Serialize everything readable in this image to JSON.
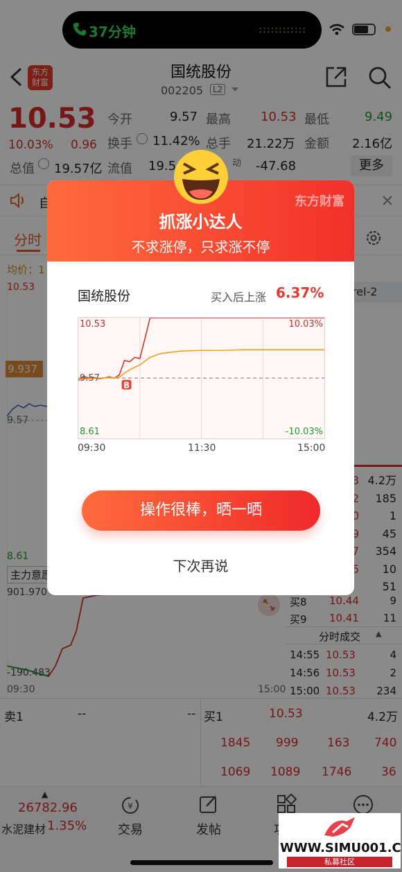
{
  "status_bar": {
    "call_time": "37分钟"
  },
  "header": {
    "logo_text_top": "东方",
    "logo_text_bottom": "财富",
    "title": "国统股份",
    "code": "002205",
    "level_badge": "L2"
  },
  "quote": {
    "price": "10.53",
    "change_pct": "10.03%",
    "change": "0.96",
    "open_label": "今开",
    "open": "9.57",
    "high_label": "最高",
    "high": "10.53",
    "low_label": "最低",
    "low": "9.49",
    "turnover_rate_label": "换手",
    "turnover_rate": "11.42%",
    "volume_label": "总手",
    "volume": "21.22万",
    "amount_label": "金额",
    "amount": "2.16亿",
    "total_value_label": "总值",
    "total_value": "19.57亿",
    "float_value_label": "流值",
    "float_value_partial": "19.5",
    "flow_partial_label": "动",
    "flow_value": "-47.68",
    "more_button": "更多"
  },
  "ticker_strip": {
    "partial_text": "自"
  },
  "tabs": {
    "intraday": "分时",
    "level2_partial": "rel-2"
  },
  "left_chart": {
    "avg_price_label": "均价：1",
    "price_top": "10.53",
    "price_badge": "9.937",
    "price_mid": "9.57",
    "price_low": "8.61",
    "indicator_label": "主力意愿",
    "indicator_top": "901.970",
    "indicator_bottom": "-190.483",
    "time_start": "09:30",
    "time_end": "15:00"
  },
  "order_book": {
    "right_volumes": [
      "4.2万",
      "185",
      "1",
      "45",
      "354",
      "10",
      "51"
    ],
    "right_partial_prices": [
      "3",
      "2",
      "0",
      "9",
      "7",
      "5"
    ],
    "rows": [
      {
        "label": "买8",
        "price": "10.44",
        "vol": "9"
      },
      {
        "label": "买9",
        "price": "10.41",
        "vol": "11"
      }
    ]
  },
  "trades": {
    "title": "分时成交",
    "rows": [
      {
        "time": "14:55",
        "price": "10.53",
        "vol": "4"
      },
      {
        "time": "14:56",
        "price": "10.53",
        "vol": "2"
      },
      {
        "time": "15:00",
        "price": "10.53",
        "vol": "234"
      }
    ]
  },
  "bottom_book": {
    "sell1_label": "卖1",
    "sell1_price": "--",
    "sell1_vol": "--",
    "buy1_label": "买1",
    "buy1_price": "10.53",
    "buy1_vol": "4.2万",
    "row1": [
      "1845",
      "999",
      "163",
      "740"
    ],
    "row2": [
      "1069",
      "1089",
      "1746",
      "36"
    ]
  },
  "bottom_nav": {
    "index_value": "26782.96",
    "index_name": "水泥建材",
    "index_change": "1.35%",
    "trade_label": "交易",
    "post_label": "发帖",
    "partial_label": "功",
    "more_label": ""
  },
  "popup": {
    "brand": "东方财富",
    "title": "抓涨小达人",
    "subtitle": "不求涨停，只求涨不停",
    "stock_name": "国统股份",
    "gain_label": "买入后上涨",
    "gain_value": "6.37%",
    "chart_watermark": "东方财富",
    "cta_label": "操作很棒，晒一晒",
    "later_label": "下次再说",
    "chart_data": {
      "type": "line",
      "x_ticks": [
        "09:30",
        "11:30",
        "15:00"
      ],
      "y_top_label": "10.53",
      "y_mid_label": "9.57",
      "y_bottom_label": "8.61",
      "pct_top_label": "10.03%",
      "pct_bottom_label": "-10.03%",
      "buy_marker": "B",
      "ylim": [
        8.61,
        10.53
      ],
      "series": [
        {
          "x": [
            0,
            5,
            10,
            15,
            20,
            25,
            30,
            35,
            40,
            45,
            50,
            55,
            60,
            65,
            70,
            75,
            80,
            90,
            100,
            120,
            140,
            160,
            180,
            200,
            220,
            240
          ],
          "values": [
            9.53,
            9.6,
            9.57,
            9.58,
            9.56,
            9.57,
            9.59,
            9.57,
            9.62,
            9.85,
            9.83,
            9.9,
            9.88,
            10.2,
            10.53,
            10.53,
            10.53,
            10.53,
            10.53,
            10.53,
            10.53,
            10.53,
            10.53,
            10.53,
            10.53,
            10.53
          ]
        },
        {
          "x": [
            0,
            20,
            40,
            45,
            50,
            55,
            60,
            65,
            70,
            80,
            90,
            100,
            120,
            140,
            160,
            180,
            200,
            220,
            240
          ],
          "values": [
            9.55,
            9.57,
            9.58,
            9.65,
            9.7,
            9.74,
            9.78,
            9.84,
            9.9,
            9.96,
            9.98,
            10.0,
            10.01,
            10.01,
            10.02,
            10.02,
            10.02,
            10.02,
            10.02
          ]
        }
      ],
      "buy_point": {
        "x": 47,
        "value": 9.62
      }
    }
  },
  "watermark": {
    "site": "WWW.SIMU001.CN",
    "tag": "私募社区"
  }
}
